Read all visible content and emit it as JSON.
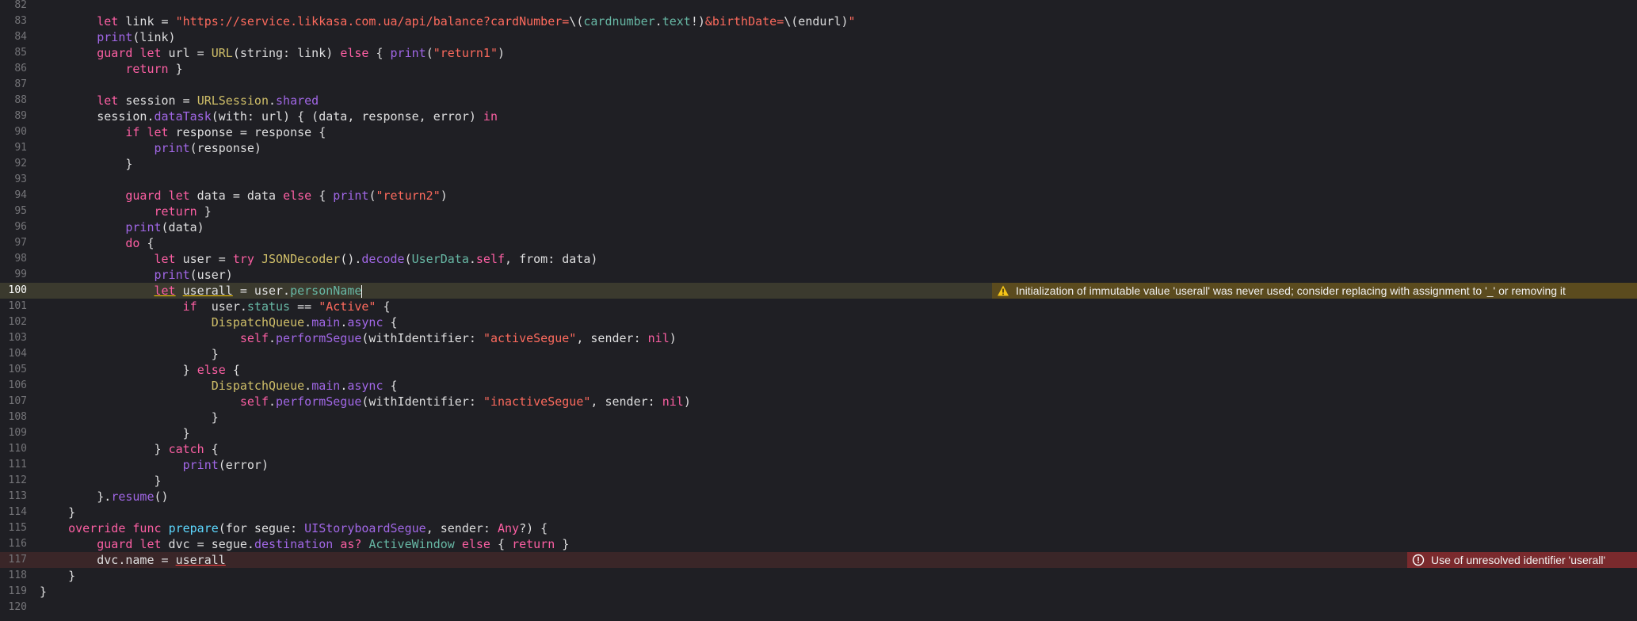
{
  "editor": {
    "lines": [
      {
        "num": "82",
        "tokens": []
      },
      {
        "num": "83",
        "tokens": [
          {
            "t": "        ",
            "c": "plain"
          },
          {
            "t": "let",
            "c": "kw"
          },
          {
            "t": " link = ",
            "c": "plain"
          },
          {
            "t": "\"https://service.likkasa.com.ua/api/balance?cardNumber=",
            "c": "str"
          },
          {
            "t": "\\(",
            "c": "plain"
          },
          {
            "t": "cardnumber",
            "c": "proj"
          },
          {
            "t": ".",
            "c": "plain"
          },
          {
            "t": "text",
            "c": "proj"
          },
          {
            "t": "!)",
            "c": "plain"
          },
          {
            "t": "&birthDate=",
            "c": "str"
          },
          {
            "t": "\\(endurl)",
            "c": "plain"
          },
          {
            "t": "\"",
            "c": "str"
          }
        ]
      },
      {
        "num": "84",
        "tokens": [
          {
            "t": "        ",
            "c": "plain"
          },
          {
            "t": "print",
            "c": "fn"
          },
          {
            "t": "(link)",
            "c": "plain"
          }
        ]
      },
      {
        "num": "85",
        "tokens": [
          {
            "t": "        ",
            "c": "plain"
          },
          {
            "t": "guard",
            "c": "kw"
          },
          {
            "t": " ",
            "c": "plain"
          },
          {
            "t": "let",
            "c": "kw"
          },
          {
            "t": " url = ",
            "c": "plain"
          },
          {
            "t": "URL",
            "c": "cls"
          },
          {
            "t": "(string: link) ",
            "c": "plain"
          },
          {
            "t": "else",
            "c": "kw"
          },
          {
            "t": " { ",
            "c": "plain"
          },
          {
            "t": "print",
            "c": "fn"
          },
          {
            "t": "(",
            "c": "plain"
          },
          {
            "t": "\"return1\"",
            "c": "str"
          },
          {
            "t": ")",
            "c": "plain"
          }
        ]
      },
      {
        "num": "86",
        "tokens": [
          {
            "t": "            ",
            "c": "plain"
          },
          {
            "t": "return",
            "c": "kw"
          },
          {
            "t": " }",
            "c": "plain"
          }
        ]
      },
      {
        "num": "87",
        "tokens": []
      },
      {
        "num": "88",
        "tokens": [
          {
            "t": "        ",
            "c": "plain"
          },
          {
            "t": "let",
            "c": "kw"
          },
          {
            "t": " session = ",
            "c": "plain"
          },
          {
            "t": "URLSession",
            "c": "cls"
          },
          {
            "t": ".",
            "c": "plain"
          },
          {
            "t": "shared",
            "c": "fn"
          }
        ]
      },
      {
        "num": "89",
        "tokens": [
          {
            "t": "        session.",
            "c": "plain"
          },
          {
            "t": "dataTask",
            "c": "fn"
          },
          {
            "t": "(with: url) { (data, response, error) ",
            "c": "plain"
          },
          {
            "t": "in",
            "c": "kw"
          }
        ]
      },
      {
        "num": "90",
        "tokens": [
          {
            "t": "            ",
            "c": "plain"
          },
          {
            "t": "if",
            "c": "kw"
          },
          {
            "t": " ",
            "c": "plain"
          },
          {
            "t": "let",
            "c": "kw"
          },
          {
            "t": " response = response {",
            "c": "plain"
          }
        ]
      },
      {
        "num": "91",
        "tokens": [
          {
            "t": "                ",
            "c": "plain"
          },
          {
            "t": "print",
            "c": "fn"
          },
          {
            "t": "(response)",
            "c": "plain"
          }
        ]
      },
      {
        "num": "92",
        "tokens": [
          {
            "t": "            }",
            "c": "plain"
          }
        ]
      },
      {
        "num": "93",
        "tokens": []
      },
      {
        "num": "94",
        "tokens": [
          {
            "t": "            ",
            "c": "plain"
          },
          {
            "t": "guard",
            "c": "kw"
          },
          {
            "t": " ",
            "c": "plain"
          },
          {
            "t": "let",
            "c": "kw"
          },
          {
            "t": " data = data ",
            "c": "plain"
          },
          {
            "t": "else",
            "c": "kw"
          },
          {
            "t": " { ",
            "c": "plain"
          },
          {
            "t": "print",
            "c": "fn"
          },
          {
            "t": "(",
            "c": "plain"
          },
          {
            "t": "\"return2\"",
            "c": "str"
          },
          {
            "t": ")",
            "c": "plain"
          }
        ]
      },
      {
        "num": "95",
        "tokens": [
          {
            "t": "                ",
            "c": "plain"
          },
          {
            "t": "return",
            "c": "kw"
          },
          {
            "t": " }",
            "c": "plain"
          }
        ]
      },
      {
        "num": "96",
        "tokens": [
          {
            "t": "            ",
            "c": "plain"
          },
          {
            "t": "print",
            "c": "fn"
          },
          {
            "t": "(data)",
            "c": "plain"
          }
        ]
      },
      {
        "num": "97",
        "tokens": [
          {
            "t": "            ",
            "c": "plain"
          },
          {
            "t": "do",
            "c": "kw"
          },
          {
            "t": " {",
            "c": "plain"
          }
        ]
      },
      {
        "num": "98",
        "tokens": [
          {
            "t": "                ",
            "c": "plain"
          },
          {
            "t": "let",
            "c": "kw"
          },
          {
            "t": " user = ",
            "c": "plain"
          },
          {
            "t": "try",
            "c": "kw"
          },
          {
            "t": " ",
            "c": "plain"
          },
          {
            "t": "JSONDecoder",
            "c": "cls"
          },
          {
            "t": "().",
            "c": "plain"
          },
          {
            "t": "decode",
            "c": "fn"
          },
          {
            "t": "(",
            "c": "plain"
          },
          {
            "t": "UserData",
            "c": "proj"
          },
          {
            "t": ".",
            "c": "plain"
          },
          {
            "t": "self",
            "c": "kw"
          },
          {
            "t": ", from: data)",
            "c": "plain"
          }
        ]
      },
      {
        "num": "99",
        "tokens": [
          {
            "t": "                ",
            "c": "plain"
          },
          {
            "t": "print",
            "c": "fn"
          },
          {
            "t": "(user)",
            "c": "plain"
          }
        ]
      },
      {
        "num": "100",
        "highlight": true,
        "cursor": true,
        "tokens": [
          {
            "t": "                ",
            "c": "plain"
          },
          {
            "t": "let",
            "c": "kw",
            "u": "warn"
          },
          {
            "t": " ",
            "c": "plain"
          },
          {
            "t": "userall",
            "c": "plain",
            "u": "warn"
          },
          {
            "t": " = user.",
            "c": "plain"
          },
          {
            "t": "personName",
            "c": "proj"
          }
        ],
        "issue": {
          "kind": "warn",
          "text": "Initialization of immutable value 'userall' was never used; consider replacing with assignment to '_' or removing it"
        }
      },
      {
        "num": "101",
        "tokens": [
          {
            "t": "                    ",
            "c": "plain"
          },
          {
            "t": "if",
            "c": "kw"
          },
          {
            "t": "  user.",
            "c": "plain"
          },
          {
            "t": "status",
            "c": "proj"
          },
          {
            "t": " == ",
            "c": "plain"
          },
          {
            "t": "\"Active\"",
            "c": "str"
          },
          {
            "t": " {",
            "c": "plain"
          }
        ]
      },
      {
        "num": "102",
        "tokens": [
          {
            "t": "                        ",
            "c": "plain"
          },
          {
            "t": "DispatchQueue",
            "c": "cls"
          },
          {
            "t": ".",
            "c": "plain"
          },
          {
            "t": "main",
            "c": "fn"
          },
          {
            "t": ".",
            "c": "plain"
          },
          {
            "t": "async",
            "c": "fn"
          },
          {
            "t": " {",
            "c": "plain"
          }
        ]
      },
      {
        "num": "103",
        "tokens": [
          {
            "t": "                            ",
            "c": "plain"
          },
          {
            "t": "self",
            "c": "kw"
          },
          {
            "t": ".",
            "c": "plain"
          },
          {
            "t": "performSegue",
            "c": "fn"
          },
          {
            "t": "(withIdentifier: ",
            "c": "plain"
          },
          {
            "t": "\"activeSegue\"",
            "c": "str"
          },
          {
            "t": ", sender: ",
            "c": "plain"
          },
          {
            "t": "nil",
            "c": "kw"
          },
          {
            "t": ")",
            "c": "plain"
          }
        ]
      },
      {
        "num": "104",
        "tokens": [
          {
            "t": "                        }",
            "c": "plain"
          }
        ]
      },
      {
        "num": "105",
        "tokens": [
          {
            "t": "                    } ",
            "c": "plain"
          },
          {
            "t": "else",
            "c": "kw"
          },
          {
            "t": " {",
            "c": "plain"
          }
        ]
      },
      {
        "num": "106",
        "tokens": [
          {
            "t": "                        ",
            "c": "plain"
          },
          {
            "t": "DispatchQueue",
            "c": "cls"
          },
          {
            "t": ".",
            "c": "plain"
          },
          {
            "t": "main",
            "c": "fn"
          },
          {
            "t": ".",
            "c": "plain"
          },
          {
            "t": "async",
            "c": "fn"
          },
          {
            "t": " {",
            "c": "plain"
          }
        ]
      },
      {
        "num": "107",
        "tokens": [
          {
            "t": "                            ",
            "c": "plain"
          },
          {
            "t": "self",
            "c": "kw"
          },
          {
            "t": ".",
            "c": "plain"
          },
          {
            "t": "performSegue",
            "c": "fn"
          },
          {
            "t": "(withIdentifier: ",
            "c": "plain"
          },
          {
            "t": "\"inactiveSegue\"",
            "c": "str"
          },
          {
            "t": ", sender: ",
            "c": "plain"
          },
          {
            "t": "nil",
            "c": "kw"
          },
          {
            "t": ")",
            "c": "plain"
          }
        ]
      },
      {
        "num": "108",
        "tokens": [
          {
            "t": "                        }",
            "c": "plain"
          }
        ]
      },
      {
        "num": "109",
        "tokens": [
          {
            "t": "                    }",
            "c": "plain"
          }
        ]
      },
      {
        "num": "110",
        "tokens": [
          {
            "t": "                } ",
            "c": "plain"
          },
          {
            "t": "catch",
            "c": "kw"
          },
          {
            "t": " {",
            "c": "plain"
          }
        ]
      },
      {
        "num": "111",
        "tokens": [
          {
            "t": "                    ",
            "c": "plain"
          },
          {
            "t": "print",
            "c": "fn"
          },
          {
            "t": "(error)",
            "c": "plain"
          }
        ]
      },
      {
        "num": "112",
        "tokens": [
          {
            "t": "                }",
            "c": "plain"
          }
        ]
      },
      {
        "num": "113",
        "tokens": [
          {
            "t": "        }.",
            "c": "plain"
          },
          {
            "t": "resume",
            "c": "fn"
          },
          {
            "t": "()",
            "c": "plain"
          }
        ]
      },
      {
        "num": "114",
        "tokens": [
          {
            "t": "    }",
            "c": "plain"
          }
        ]
      },
      {
        "num": "115",
        "tokens": [
          {
            "t": "    ",
            "c": "plain"
          },
          {
            "t": "override",
            "c": "kw"
          },
          {
            "t": " ",
            "c": "plain"
          },
          {
            "t": "func",
            "c": "kw"
          },
          {
            "t": " ",
            "c": "plain"
          },
          {
            "t": "prepare",
            "c": "typ"
          },
          {
            "t": "(for segue: ",
            "c": "plain"
          },
          {
            "t": "UIStoryboardSegue",
            "c": "fn"
          },
          {
            "t": ", sender: ",
            "c": "plain"
          },
          {
            "t": "Any",
            "c": "kw"
          },
          {
            "t": "?) {",
            "c": "plain"
          }
        ]
      },
      {
        "num": "116",
        "tokens": [
          {
            "t": "        ",
            "c": "plain"
          },
          {
            "t": "guard",
            "c": "kw"
          },
          {
            "t": " ",
            "c": "plain"
          },
          {
            "t": "let",
            "c": "kw"
          },
          {
            "t": " dvc = segue.",
            "c": "plain"
          },
          {
            "t": "destination",
            "c": "fn"
          },
          {
            "t": " ",
            "c": "plain"
          },
          {
            "t": "as?",
            "c": "kw"
          },
          {
            "t": " ",
            "c": "plain"
          },
          {
            "t": "ActiveWindow",
            "c": "proj"
          },
          {
            "t": " ",
            "c": "plain"
          },
          {
            "t": "else",
            "c": "kw"
          },
          {
            "t": " { ",
            "c": "plain"
          },
          {
            "t": "return",
            "c": "kw"
          },
          {
            "t": " }",
            "c": "plain"
          }
        ]
      },
      {
        "num": "117",
        "tokens": [
          {
            "t": "        dvc.name = ",
            "c": "plain"
          },
          {
            "t": "userall",
            "c": "plain",
            "u": "err"
          }
        ],
        "issue": {
          "kind": "err",
          "text": "Use of unresolved identifier 'userall'"
        }
      },
      {
        "num": "118",
        "tokens": [
          {
            "t": "    }",
            "c": "plain"
          }
        ]
      },
      {
        "num": "119",
        "tokens": [
          {
            "t": "}",
            "c": "plain"
          }
        ]
      },
      {
        "num": "120",
        "tokens": []
      }
    ]
  },
  "colors": {
    "background": "#1f1f24",
    "keyword": "#fc5fa3",
    "string": "#fc6a5d",
    "method": "#a167e6",
    "declaration": "#5dd8ff",
    "class": "#d0bf69",
    "project": "#67b7a4",
    "warning_bg": "#5b4b1e",
    "error_bg": "#7a2a2d"
  },
  "icons": {
    "warning": "warning-triangle-icon",
    "error": "error-circle-icon"
  }
}
